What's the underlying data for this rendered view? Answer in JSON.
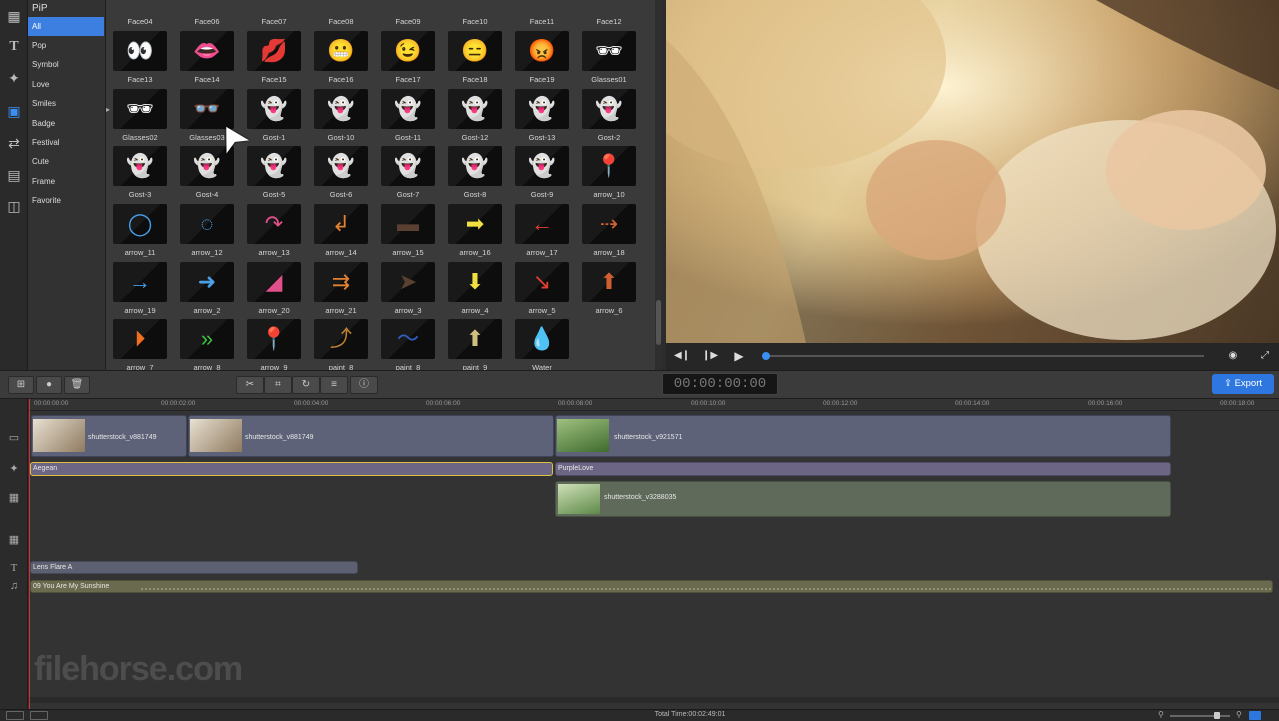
{
  "sidebar": {
    "tools": [
      "media-icon",
      "text-icon",
      "effects-icon",
      "pip-icon",
      "transition-icon",
      "filter-icon",
      "overlay-icon"
    ]
  },
  "categories": {
    "header": "PiP",
    "items": [
      "All",
      "Pop",
      "Symbol",
      "Love",
      "Smiles",
      "Badge",
      "Festival",
      "Cute",
      "Frame",
      "Favorite"
    ],
    "selected": "All"
  },
  "grid": {
    "top_labels": [
      "Face04",
      "Face06",
      "Face07",
      "Face08",
      "Face09",
      "Face10",
      "Face11",
      "Face12"
    ],
    "rows": [
      {
        "labels": [
          "Face13",
          "Face14",
          "Face15",
          "Face16",
          "Face17",
          "Face18",
          "Face19",
          "Glasses01"
        ],
        "glyphs": [
          "👀",
          "👄",
          "💋",
          "😬",
          "😉",
          "😑",
          "😡",
          "🕶"
        ]
      },
      {
        "labels": [
          "Glasses02",
          "Glasses03",
          "Gost-1",
          "Gost-10",
          "Gost-11",
          "Gost-12",
          "Gost-13",
          "Gost-2"
        ],
        "glyphs": [
          "🕶",
          "👓",
          "👻",
          "👻",
          "👻",
          "👻",
          "👻",
          "👻"
        ]
      },
      {
        "labels": [
          "Gost-3",
          "Gost-4",
          "Gost-5",
          "Gost-6",
          "Gost-7",
          "Gost-8",
          "Gost-9",
          "arrow_10"
        ],
        "glyphs": [
          "👻",
          "👻",
          "👻",
          "👻",
          "👻",
          "👻",
          "👻",
          "📍"
        ]
      },
      {
        "labels": [
          "arrow_11",
          "arrow_12",
          "arrow_13",
          "arrow_14",
          "arrow_15",
          "arrow_16",
          "arrow_17",
          "arrow_18"
        ],
        "glyphs": [
          "◯",
          "◌",
          "↷",
          "↲",
          "▬",
          "➡",
          "←",
          "⇢"
        ]
      },
      {
        "labels": [
          "arrow_19",
          "arrow_2",
          "arrow_20",
          "arrow_21",
          "arrow_3",
          "arrow_4",
          "arrow_5",
          "arrow_6"
        ],
        "glyphs": [
          "→",
          "➜",
          "◢",
          "⇉",
          "➤",
          "⬇",
          "↘",
          "⬆"
        ]
      },
      {
        "labels": [
          "arrow_7",
          "arrow_8",
          "arrow_9",
          "paint_8",
          "paint_8",
          "paint_9",
          "Water",
          ""
        ],
        "glyphs": [
          "⏵",
          "»",
          "📍",
          "⤴",
          "〜",
          "⬆",
          "💧",
          ""
        ]
      }
    ]
  },
  "player": {
    "buttons": [
      "step-back",
      "step-forward",
      "play"
    ],
    "right_buttons": [
      "snapshot",
      "fullscreen"
    ]
  },
  "toolbar": {
    "timecode": "00:00:00:00",
    "export_label": "Export"
  },
  "ruler": {
    "ticks": [
      "00:00:00:00",
      "00:00:02:00",
      "00:00:04:00",
      "00:00:06:00",
      "00:00:08:00",
      "00:00:10:00",
      "00:00:12:00",
      "00:00:14:00",
      "00:00:16:00",
      "00:00:18:00"
    ]
  },
  "tracks": {
    "video": [
      {
        "label": "shutterstock_v881749"
      },
      {
        "label": "shutterstock_v881749"
      },
      {
        "label": "shutterstock_v921571"
      }
    ],
    "transitions": [
      {
        "label": "Aegean"
      },
      {
        "label": "PurpleLove"
      }
    ],
    "pip": [
      {
        "label": "shutterstock_v3288035"
      }
    ],
    "text": [
      {
        "label": "Lens Flare A"
      }
    ],
    "audio": [
      {
        "label": "09 You Are My Sunshine"
      }
    ]
  },
  "status": {
    "total_time": "Total Time:00:02:49:01"
  },
  "watermark": {
    "text": "filehorse.com"
  }
}
